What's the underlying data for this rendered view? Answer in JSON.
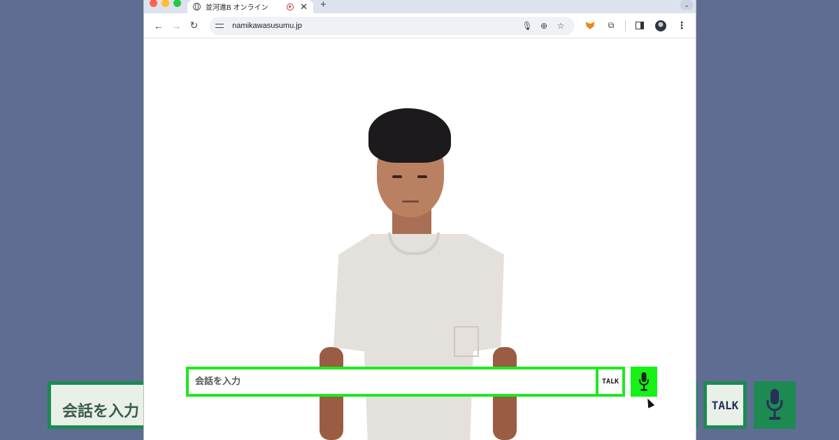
{
  "browser": {
    "tab_title": "並河進B オンライン",
    "tab_close": "✕",
    "new_tab": "+",
    "tab_list": "⌄",
    "url": "namikawasusumu.jp",
    "nav": {
      "back": "←",
      "forward": "→",
      "reload": "↻"
    },
    "omnibox_icons": {
      "mic": "🎙",
      "zoom": "⊕",
      "bookmark": "☆"
    },
    "extensions_icon": "⧉",
    "menu": "⋮"
  },
  "chat": {
    "placeholder": "会話を入力",
    "talk_label": "TALK",
    "accent_color": "#1fe81f",
    "mic_bg_color": "#16f216"
  },
  "background_echo": {
    "placeholder": "会話を入力",
    "talk_label": "TALK",
    "accent_color": "#1d8a52"
  },
  "icons": [
    "globe-icon",
    "recording-icon",
    "back-icon",
    "forward-icon",
    "reload-icon",
    "site-settings-icon",
    "mic-icon",
    "zoom-icon",
    "bookmark-star-icon",
    "metamask-fox-icon",
    "extensions-puzzle-icon",
    "side-panel-icon",
    "profile-avatar-icon",
    "menu-kebab-icon",
    "microphone-icon"
  ]
}
